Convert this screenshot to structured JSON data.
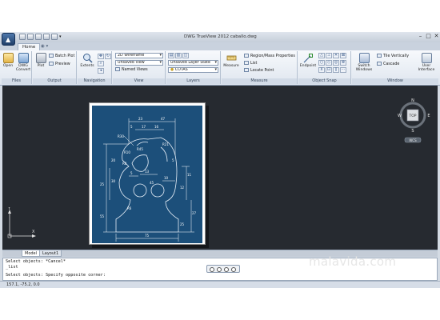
{
  "app": {
    "window_title": "DWG TrueView 2012    caballo.dwg",
    "app_menu_icon": "autocad-logo-icon",
    "window_controls": [
      "–",
      "□",
      "✕"
    ]
  },
  "ribbon_tabs": [
    {
      "label": "Home",
      "active": true
    },
    {
      "label": "◉ ▾",
      "active": false
    }
  ],
  "panels": {
    "files": {
      "title": "Files",
      "open_label": "Open",
      "convert_label": "DWG Convert"
    },
    "output": {
      "title": "Output",
      "plot_label": "Plot",
      "batch_plot_label": "Batch Plot",
      "preview_label": "Preview"
    },
    "navigation": {
      "title": "Navigation",
      "extents_label": "Extents"
    },
    "view": {
      "title": "View",
      "visual_style": "2D Wireframe",
      "saved_view": "Unsaved View",
      "named_views_label": "Named Views"
    },
    "layers": {
      "title": "Layers",
      "layer_state": "Unsaved Layer State",
      "current_layer": "COTAS"
    },
    "measure": {
      "title": "Measure",
      "measure_label": "Measure",
      "region_label": "Region/Mass Properties",
      "list_label": "List",
      "locate_point_label": "Locate Point"
    },
    "object_snap": {
      "title": "Object Snap",
      "endpoint_label": "Endpoint"
    },
    "window": {
      "title": "Window",
      "switch_windows_label": "Switch Windows",
      "tile_vertically_label": "Tile Vertically",
      "cascade_label": "Cascade",
      "user_interface_label": "User Interface"
    }
  },
  "viewcube": {
    "top_label": "TOP",
    "north": "N",
    "south": "S",
    "east": "E",
    "west": "W",
    "wcs_label": "WCS"
  },
  "ucs": {
    "x_label": "X",
    "y_label": "Y"
  },
  "drawing": {
    "dims": [
      "23",
      "47",
      "5",
      "17",
      "16",
      "R30",
      "R21",
      "R10",
      "R8",
      "R45",
      "13",
      "25",
      "30",
      "5",
      "11",
      "12",
      "27",
      "25",
      "55",
      "R6",
      "75",
      "20",
      "10",
      "45",
      "5"
    ]
  },
  "layout_tabs": [
    {
      "label": "Model",
      "active": true
    },
    {
      "label": "Layout1",
      "active": false
    }
  ],
  "command_lines": [
    "Select objects: *Cancel*",
    "_list",
    "",
    "Select objects: Specify opposite corner:"
  ],
  "status": {
    "coordinates": "157.1, -75.2, 0.0"
  },
  "watermark": "malavida.com",
  "colors": {
    "canvas_bg": "#262a30",
    "drawing_bg": "#1c4f7a",
    "line_color": "#e6eef7",
    "ribbon_bg": "#e8edf4",
    "accent": "#2f5c94"
  }
}
